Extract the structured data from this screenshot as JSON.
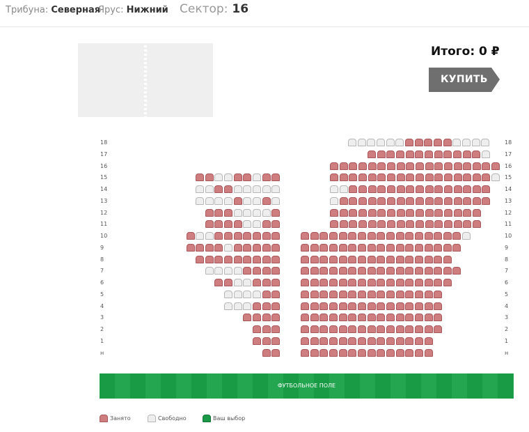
{
  "header": {
    "tribune_label": "Трибуна:",
    "tribune_value": "Северная",
    "tier_label": "Ярус:",
    "tier_value": "Нижний",
    "sector_label": "Сектор:",
    "sector_value": "16"
  },
  "order": {
    "total": "Итого: 0 ₽",
    "buy_label": "КУПИТЬ"
  },
  "field": {
    "label": "ФУТБОЛЬНОЕ ПОЛЕ"
  },
  "legend": {
    "taken": "Занято",
    "free": "Свободно",
    "mine": "Ваш выбор"
  },
  "colors": {
    "taken": "#cf7e80",
    "free": "#eeeeee",
    "mine": "#1a9a46",
    "field": "#199a45",
    "buy_button": "#6f6f6f"
  },
  "rows": [
    {
      "label": "18",
      "left": "",
      "right": "FFFFFFTTTTTFFFF"
    },
    {
      "label": "17",
      "left": "",
      "right": "TTTTTTTTTTTTF"
    },
    {
      "label": "16",
      "left": "",
      "right": "TTTTTTTTTTTTTTTTTT"
    },
    {
      "label": "15",
      "left": "TTFFTTFTT",
      "right": "TTTTTTTTTTTTTTTTTF"
    },
    {
      "label": "14",
      "left": "FFTTFFFFF",
      "right": "FFTTTTTTTTTTTTTTT"
    },
    {
      "label": "13",
      "left": "FFFFTFFTF",
      "right": "FTTTTTTTTTTTTTTTT"
    },
    {
      "label": "12",
      "left": "TTTFFFFT",
      "right": "TTTTTTTTTTTTTTTT"
    },
    {
      "label": "11",
      "left": "TTTTFFTT",
      "right": "TTTTTTTTTTTTTTTT"
    },
    {
      "label": "10",
      "left": "TFFTTTTTTT",
      "right": "TTTTTTTTTTTTTTTTTF"
    },
    {
      "label": "9",
      "left": "TTTTFTTTTT",
      "right": "TTTTTTTTTTTTTTTTT"
    },
    {
      "label": "8",
      "left": "TTTTTTTTT",
      "right": "TTTTTTTTTTTTTTTT"
    },
    {
      "label": "7",
      "left": "FFFFTTTT",
      "right": "TTTTTTTTTTTTTTTTT"
    },
    {
      "label": "6",
      "left": "TTFFTTT",
      "right": "TTTTTTTTTTTTTTTT"
    },
    {
      "label": "5",
      "left": "FFFFTT",
      "right": "TTTTTTTTTTTTTTT"
    },
    {
      "label": "4",
      "left": "FFFTTT",
      "right": "TTTTTTTTTTTTTTT"
    },
    {
      "label": "3",
      "left": "TTTT",
      "right": "TTTTTTTTTTTTTTT"
    },
    {
      "label": "2",
      "left": "TTT",
      "right": "TTTTTTTTTTTTTTT"
    },
    {
      "label": "1",
      "left": "TTT",
      "right": "TTTTTTTTTTTTTT"
    },
    {
      "label": "н",
      "left": "TT",
      "right": "TTTTTTTTTTTTTT"
    }
  ]
}
